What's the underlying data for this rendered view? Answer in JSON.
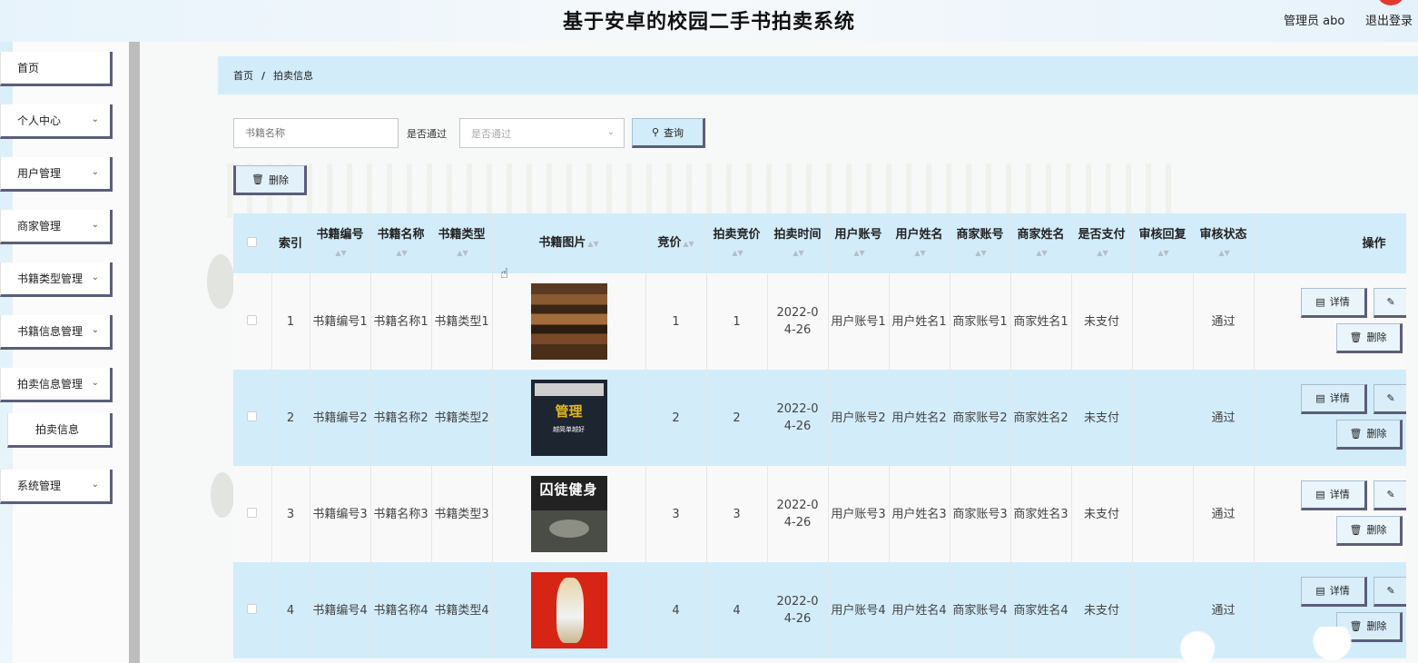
{
  "header": {
    "title": "基于安卓的校园二手书拍卖系统",
    "user": "管理员 abo",
    "logout": "退出登录"
  },
  "sidebar": {
    "items": [
      {
        "label": "首页",
        "chevron": false
      },
      {
        "label": "个人中心",
        "chevron": true
      },
      {
        "label": "用户管理",
        "chevron": true
      },
      {
        "label": "商家管理",
        "chevron": true
      },
      {
        "label": "书籍类型管理",
        "chevron": true
      },
      {
        "label": "书籍信息管理",
        "chevron": true
      },
      {
        "label": "拍卖信息管理",
        "chevron": true
      },
      {
        "label": "拍卖信息",
        "chevron": false,
        "sub": true
      },
      {
        "label": "系统管理",
        "chevron": true
      }
    ]
  },
  "breadcrumb": {
    "home": "首页",
    "sep": "/",
    "current": "拍卖信息"
  },
  "filters": {
    "name_placeholder": "书籍名称",
    "pass_label": "是否通过",
    "pass_placeholder": "是否通过",
    "query_label": "查询"
  },
  "toolbar": {
    "delete_label": "删除"
  },
  "table": {
    "columns": [
      {
        "label": "",
        "sort": false
      },
      {
        "label": "索引",
        "sort": false
      },
      {
        "label": "书籍编号",
        "sort": true
      },
      {
        "label": "书籍名称",
        "sort": true
      },
      {
        "label": "书籍类型",
        "sort": true
      },
      {
        "label": "书籍图片",
        "sort": true
      },
      {
        "label": "竞价",
        "sort": true
      },
      {
        "label": "拍卖竞价",
        "sort": true
      },
      {
        "label": "拍卖时间",
        "sort": true
      },
      {
        "label": "用户账号",
        "sort": true
      },
      {
        "label": "用户姓名",
        "sort": true
      },
      {
        "label": "商家账号",
        "sort": true
      },
      {
        "label": "商家姓名",
        "sort": true
      },
      {
        "label": "是否支付",
        "sort": true
      },
      {
        "label": "审核回复",
        "sort": true
      },
      {
        "label": "审核状态",
        "sort": true
      },
      {
        "label": "操作",
        "sort": false
      }
    ],
    "rows": [
      {
        "index": "1",
        "book_no": "书籍编号1",
        "book_name": "书籍名称1",
        "book_type": "书籍类型1",
        "image": "book-cover-stacked-books",
        "bid": "1",
        "auction_bid": "1",
        "time": "2022-04-26",
        "user_account": "用户账号1",
        "user_name": "用户姓名1",
        "merchant_account": "商家账号1",
        "merchant_name": "商家姓名1",
        "paid": "未支付",
        "reply": "",
        "status": "通过"
      },
      {
        "index": "2",
        "book_no": "书籍编号2",
        "book_name": "书籍名称2",
        "book_type": "书籍类型2",
        "image": "book-cover-guanli",
        "bid": "2",
        "auction_bid": "2",
        "time": "2022-04-26",
        "user_account": "用户账号2",
        "user_name": "用户姓名2",
        "merchant_account": "商家账号2",
        "merchant_name": "商家姓名2",
        "paid": "未支付",
        "reply": "",
        "status": "通过"
      },
      {
        "index": "3",
        "book_no": "书籍编号3",
        "book_name": "书籍名称3",
        "book_type": "书籍类型3",
        "image": "book-cover-fitness",
        "bid": "3",
        "auction_bid": "3",
        "time": "2022-04-26",
        "user_account": "用户账号3",
        "user_name": "用户姓名3",
        "merchant_account": "商家账号3",
        "merchant_name": "商家姓名3",
        "paid": "未支付",
        "reply": "",
        "status": "通过"
      },
      {
        "index": "4",
        "book_no": "书籍编号4",
        "book_name": "书籍名称4",
        "book_type": "书籍类型4",
        "image": "book-cover-red-figure",
        "bid": "4",
        "auction_bid": "4",
        "time": "2022-04-26",
        "user_account": "用户账号4",
        "user_name": "用户姓名4",
        "merchant_account": "商家账号4",
        "merchant_name": "商家姓名4",
        "paid": "未支付",
        "reply": "",
        "status": "通过"
      }
    ],
    "actions": {
      "detail": "详情",
      "delete": "删除"
    },
    "book_covers": {
      "guanli_title": "管理",
      "guanli_subtitle": "越简单越好",
      "fitness_title": "囚徒健身"
    }
  },
  "colors": {
    "accent": "#d2ecfa",
    "border_dark": "#5b5e7a"
  }
}
